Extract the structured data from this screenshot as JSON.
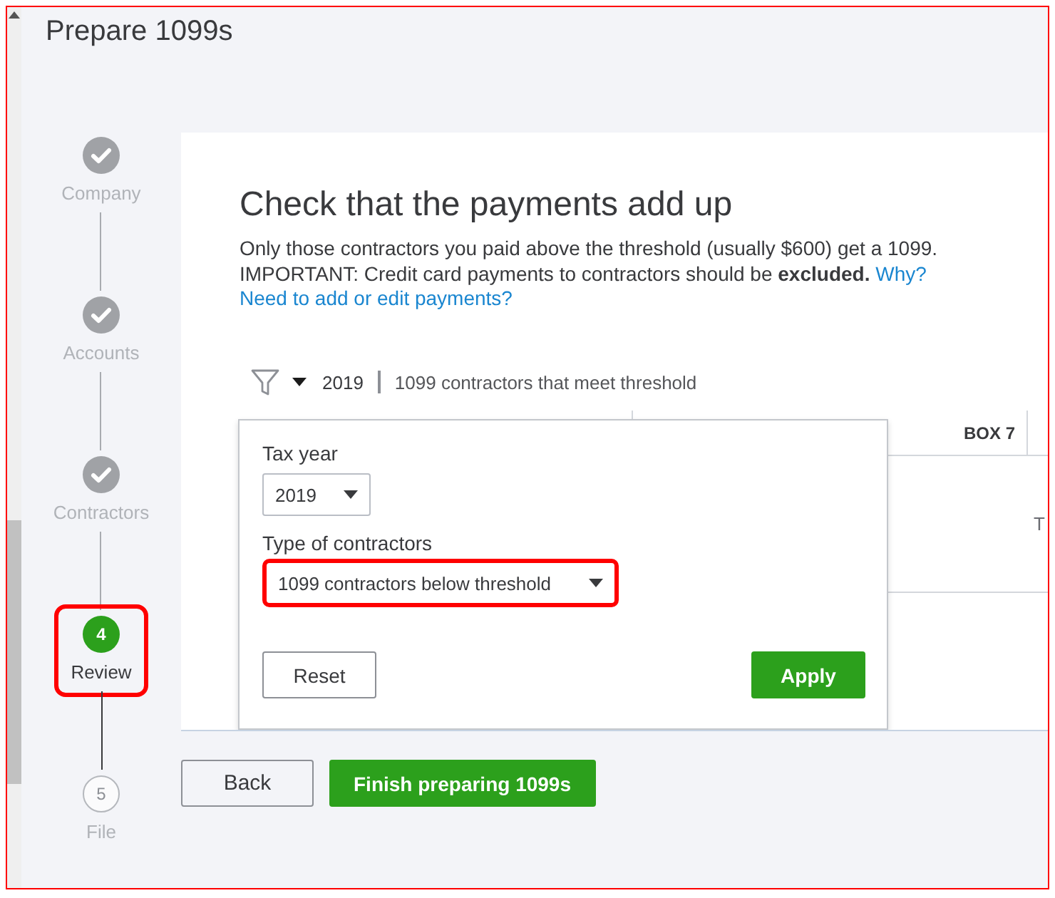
{
  "page": {
    "title": "Prepare 1099s"
  },
  "steps": [
    {
      "label": "Company",
      "kind": "completed",
      "highlighted": false
    },
    {
      "label": "Accounts",
      "kind": "completed",
      "highlighted": false
    },
    {
      "label": "Contractors",
      "kind": "completed",
      "highlighted": false
    },
    {
      "number": "4",
      "label": "Review",
      "kind": "current",
      "highlighted": true
    },
    {
      "number": "5",
      "label": "File",
      "kind": "upcoming",
      "highlighted": false
    }
  ],
  "review": {
    "heading": "Check that the payments add up",
    "intro": "Only those contractors you paid above the threshold (usually $600) get a 1099.",
    "notice": "IMPORTANT: Credit card payments to contractors should be **excluded.**",
    "why_link": "Why?",
    "edit_link": "Need to add or edit payments?",
    "filter": {
      "year": "2019",
      "summary": "1099 contractors that meet threshold",
      "expanded": true
    },
    "table": {
      "columns": [
        {
          "label": "BOX 7"
        }
      ],
      "rows": [
        {
          "cells": [
            "T"
          ]
        }
      ]
    },
    "filter_panel": {
      "tax_year": {
        "label": "Tax year",
        "value": "2019"
      },
      "contractor_type": {
        "label": "Type of contractors",
        "value": "1099 contractors below threshold",
        "highlighted": true
      },
      "buttons": [
        {
          "label": "Reset",
          "kind": "secondary"
        },
        {
          "label": "Apply",
          "kind": "primary"
        }
      ]
    }
  },
  "actions": [
    {
      "label": "Back",
      "kind": "secondary"
    },
    {
      "label": "Finish preparing 1099s",
      "kind": "primary"
    }
  ]
}
